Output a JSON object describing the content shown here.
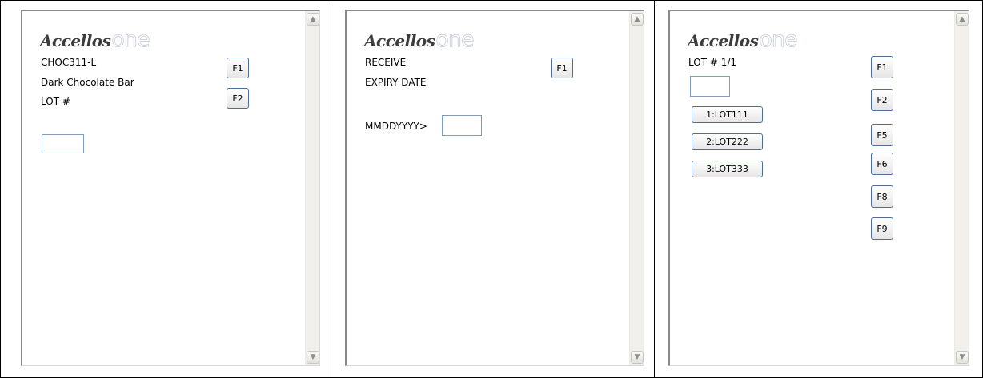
{
  "panels": [
    {
      "logo": {
        "main": "Accellos",
        "suffix": "one"
      },
      "lines": [
        "CHOC311-L",
        "Dark Chocolate Bar",
        "LOT #"
      ],
      "keys": [
        "F1",
        "F2"
      ],
      "input": {
        "value": ""
      }
    },
    {
      "logo": {
        "main": "Accellos",
        "suffix": "one"
      },
      "lines": [
        "RECEIVE",
        "EXPIRY DATE"
      ],
      "prompt": "MMDDYYYY>",
      "keys": [
        "F1"
      ],
      "input": {
        "value": ""
      }
    },
    {
      "logo": {
        "main": "Accellos",
        "suffix": "one"
      },
      "lines": [
        "LOT # 1/1"
      ],
      "lot_options": [
        "1:LOT111",
        "2:LOT222",
        "3:LOT333"
      ],
      "keys": [
        "F1",
        "F2",
        "F5",
        "F6",
        "F8",
        "F9"
      ],
      "input": {
        "value": ""
      }
    }
  ],
  "scrollbar": {
    "up_icon": "▲",
    "down_icon": "▼"
  },
  "colors": {
    "button_border": "#4d6f97",
    "field_border": "#7f9db9"
  }
}
